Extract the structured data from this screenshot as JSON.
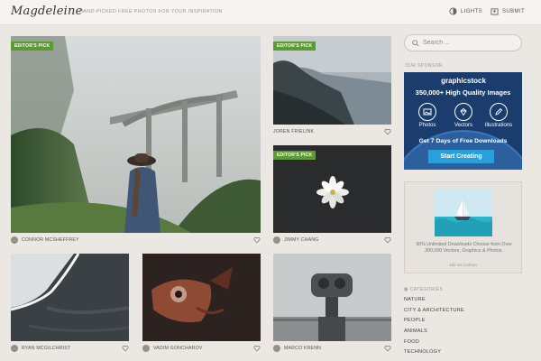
{
  "header": {
    "logo": "Magdeleine",
    "tagline": "HAND-PICKED FREE PHOTOS FOR YOUR INSPIRATION",
    "lights_label": "LIGHTS",
    "submit_label": "SUBMIT"
  },
  "photos": [
    {
      "author": "CONNOR MCSHEFFREY",
      "badge": "EDITOR'S PICK",
      "subject": "bridge-in-fog"
    },
    {
      "author": "JOREN FRIELINK",
      "badge": "EDITOR'S PICK",
      "subject": "coastline"
    },
    {
      "author": "JIMMY CHANG",
      "badge": "EDITOR'S PICK",
      "subject": "white-flower"
    },
    {
      "author": "RYAN MCGILCHRIST",
      "subject": "ocean-waves"
    },
    {
      "author": "VADIM GONCHAROV",
      "subject": "fish"
    },
    {
      "author": "MARCO KRENN",
      "subject": "coin-binoculars"
    }
  ],
  "sidebar": {
    "search_placeholder": "Search ...",
    "sponsor_label": "OUR SPONSOR",
    "ad": {
      "brand": "graphicstock",
      "headline": "350,000+ High Quality Images",
      "features": [
        "Photos",
        "Vectors",
        "Illustrations"
      ],
      "offer": "Get 7 Days of Free Downloads",
      "cta": "Start Creating"
    },
    "carbon": {
      "text": "90% Unlimited Downloads Choose from Over 300,000 Vectors, Graphics & Photos.",
      "via": "ads via Carbon"
    },
    "categories_label": "CATEGORIES",
    "categories": [
      "NATURE",
      "CITY & ARCHITECTURE",
      "PEOPLE",
      "ANIMALS",
      "FOOD",
      "TECHNOLOGY"
    ]
  },
  "colors": {
    "background": "#ebe8e3",
    "badge": "#5c9a32",
    "ad_background": "#1b3d6e",
    "ad_button": "#27a0db"
  }
}
